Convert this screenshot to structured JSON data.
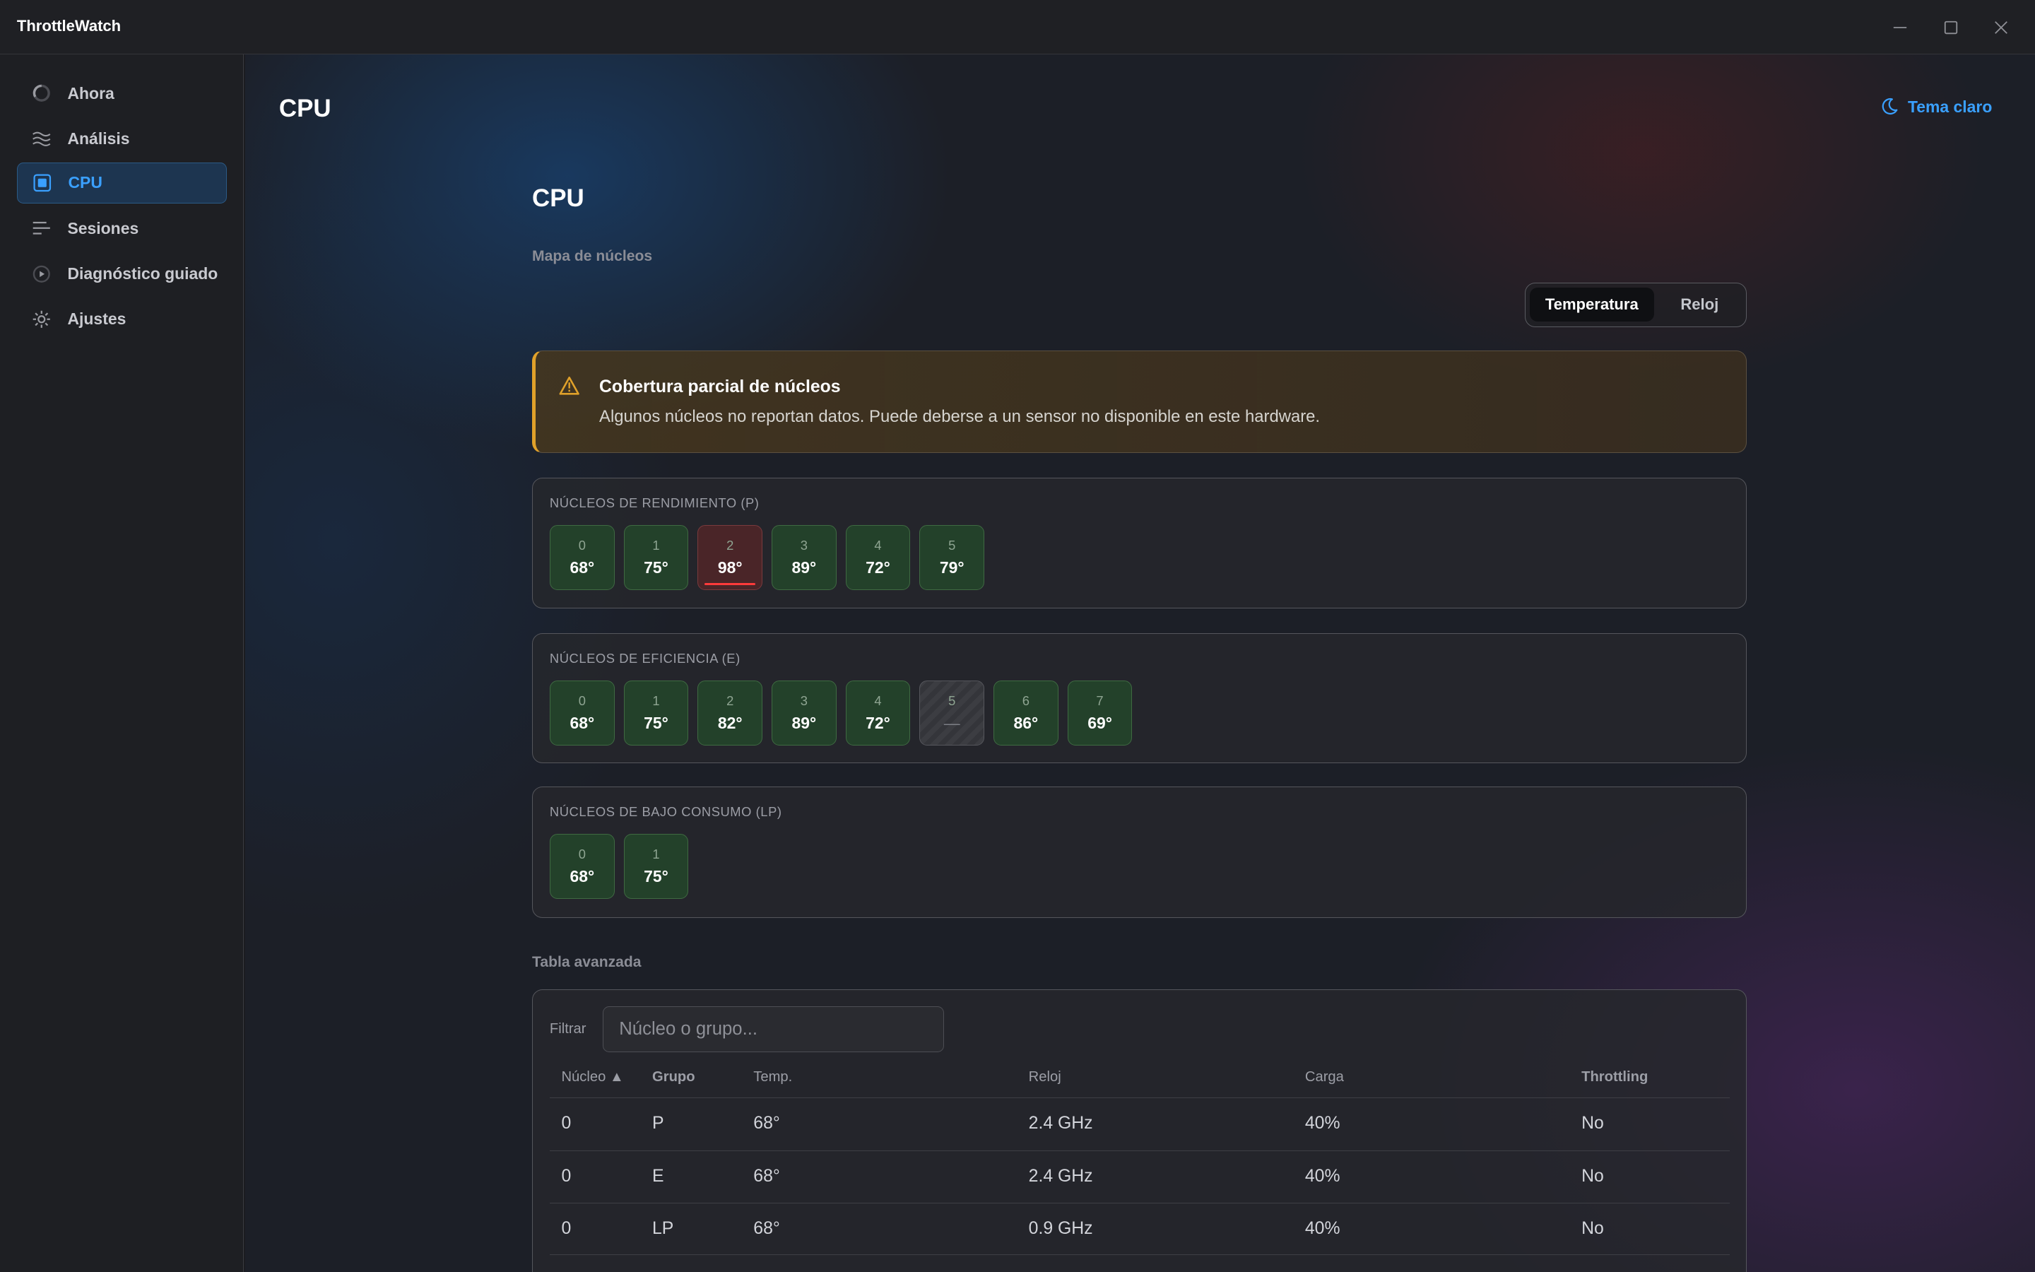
{
  "app": {
    "title": "ThrottleWatch"
  },
  "sidebar": {
    "items": [
      {
        "label": "Ahora",
        "icon": "loading-circle-icon",
        "active": false
      },
      {
        "label": "Análisis",
        "icon": "waves-icon",
        "active": false
      },
      {
        "label": "CPU",
        "icon": "chip-icon",
        "active": true
      },
      {
        "label": "Sesiones",
        "icon": "list-lines-icon",
        "active": false
      },
      {
        "label": "Diagnóstico guiado",
        "icon": "play-circle-icon",
        "active": false
      },
      {
        "label": "Ajustes",
        "icon": "gear-icon",
        "active": false
      }
    ]
  },
  "header": {
    "title": "CPU",
    "theme_toggle": "Tema claro"
  },
  "content": {
    "title": "CPU",
    "core_map_label": "Mapa de núcleos",
    "segments": {
      "active": "Temperatura",
      "inactive": "Reloj"
    },
    "warning": {
      "title": "Cobertura parcial de núcleos",
      "body": "Algunos núcleos no reportan datos. Puede deberse a un sensor no disponible en este hardware."
    },
    "groups": [
      {
        "label": "NÚCLEOS DE RENDIMIENTO (P)",
        "cores": [
          {
            "index": "0",
            "value": "68°",
            "state": "ok"
          },
          {
            "index": "1",
            "value": "75°",
            "state": "ok"
          },
          {
            "index": "2",
            "value": "98°",
            "state": "hot"
          },
          {
            "index": "3",
            "value": "89°",
            "state": "ok"
          },
          {
            "index": "4",
            "value": "72°",
            "state": "ok"
          },
          {
            "index": "5",
            "value": "79°",
            "state": "ok"
          }
        ]
      },
      {
        "label": "NÚCLEOS DE EFICIENCIA (E)",
        "cores": [
          {
            "index": "0",
            "value": "68°",
            "state": "ok"
          },
          {
            "index": "1",
            "value": "75°",
            "state": "ok"
          },
          {
            "index": "2",
            "value": "82°",
            "state": "ok"
          },
          {
            "index": "3",
            "value": "89°",
            "state": "ok"
          },
          {
            "index": "4",
            "value": "72°",
            "state": "ok"
          },
          {
            "index": "5",
            "value": "—",
            "state": "na"
          },
          {
            "index": "6",
            "value": "86°",
            "state": "ok"
          },
          {
            "index": "7",
            "value": "69°",
            "state": "ok"
          }
        ]
      },
      {
        "label": "NÚCLEOS DE BAJO CONSUMO (LP)",
        "cores": [
          {
            "index": "0",
            "value": "68°",
            "state": "ok"
          },
          {
            "index": "1",
            "value": "75°",
            "state": "ok"
          }
        ]
      }
    ],
    "advanced_table": {
      "label": "Tabla avanzada",
      "filter_label": "Filtrar",
      "filter_placeholder": "Núcleo o grupo...",
      "headers": [
        "Núcleo ▲",
        "Grupo",
        "Temp.",
        "Reloj",
        "Carga",
        "Throttling"
      ],
      "rows": [
        [
          "0",
          "P",
          "68°",
          "2.4 GHz",
          "40%",
          "No"
        ],
        [
          "0",
          "E",
          "68°",
          "2.4 GHz",
          "40%",
          "No"
        ],
        [
          "0",
          "LP",
          "68°",
          "0.9 GHz",
          "40%",
          "No"
        ]
      ]
    }
  },
  "colors": {
    "accent": "#3aa0ff",
    "ok_tile": "#23412a",
    "hot_tile": "#4a2528",
    "warning": "#e0a12a"
  }
}
